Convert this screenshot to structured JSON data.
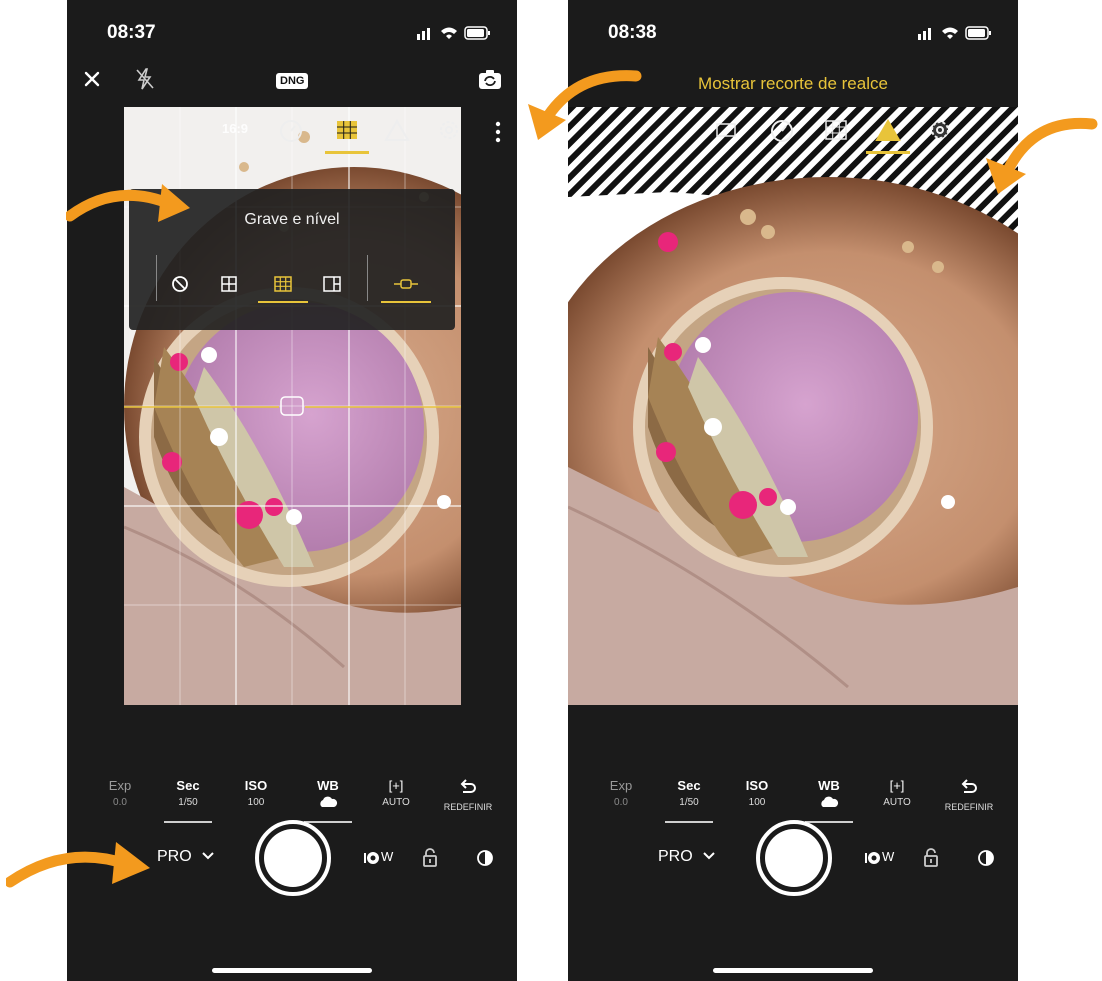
{
  "left_screen": {
    "status_time": "08:37",
    "dng_label": "DNG",
    "aspect_label": "16:9",
    "grid_panel": {
      "title": "Grave e nível"
    },
    "settings": [
      {
        "label": "Exp",
        "value": "0.0",
        "active": false
      },
      {
        "label": "Sec",
        "value": "1/50",
        "active": true
      },
      {
        "label": "ISO",
        "value": "100",
        "active": false
      },
      {
        "label": "WB",
        "value": "",
        "active": false
      },
      {
        "label": "[+]",
        "value": "AUTO",
        "active": false
      },
      {
        "label": "",
        "value": "REDEFINIR",
        "active": false
      }
    ],
    "mode": "PRO",
    "lens_label": "W"
  },
  "right_screen": {
    "status_time": "08:38",
    "highlight_title": "Mostrar recorte de realce",
    "settings": [
      {
        "label": "Exp",
        "value": "0.0",
        "active": false
      },
      {
        "label": "Sec",
        "value": "1/50",
        "active": true
      },
      {
        "label": "ISO",
        "value": "100",
        "active": false
      },
      {
        "label": "WB",
        "value": "",
        "active": false
      },
      {
        "label": "[+]",
        "value": "AUTO",
        "active": false
      },
      {
        "label": "",
        "value": "REDEFINIR",
        "active": false
      }
    ],
    "mode": "PRO",
    "lens_label": "W"
  },
  "colors": {
    "accent": "#e8c43a",
    "annotation_arrow": "#f39a1e",
    "background": "#1b1b1b",
    "smoothie": "#c38dbd",
    "flower": "#e8267a"
  },
  "icons": {
    "close": "close-icon",
    "flash": "flash-off-icon",
    "flip": "flip-camera-icon",
    "timer": "timer-icon",
    "grid": "grid-icon",
    "level": "highlight-clipping-icon",
    "settings": "gear-icon",
    "more": "more-vertical-icon",
    "reset": "reset-icon",
    "lens": "lens-icon",
    "lock": "lock-icon",
    "drop": "raw-drop-icon"
  }
}
